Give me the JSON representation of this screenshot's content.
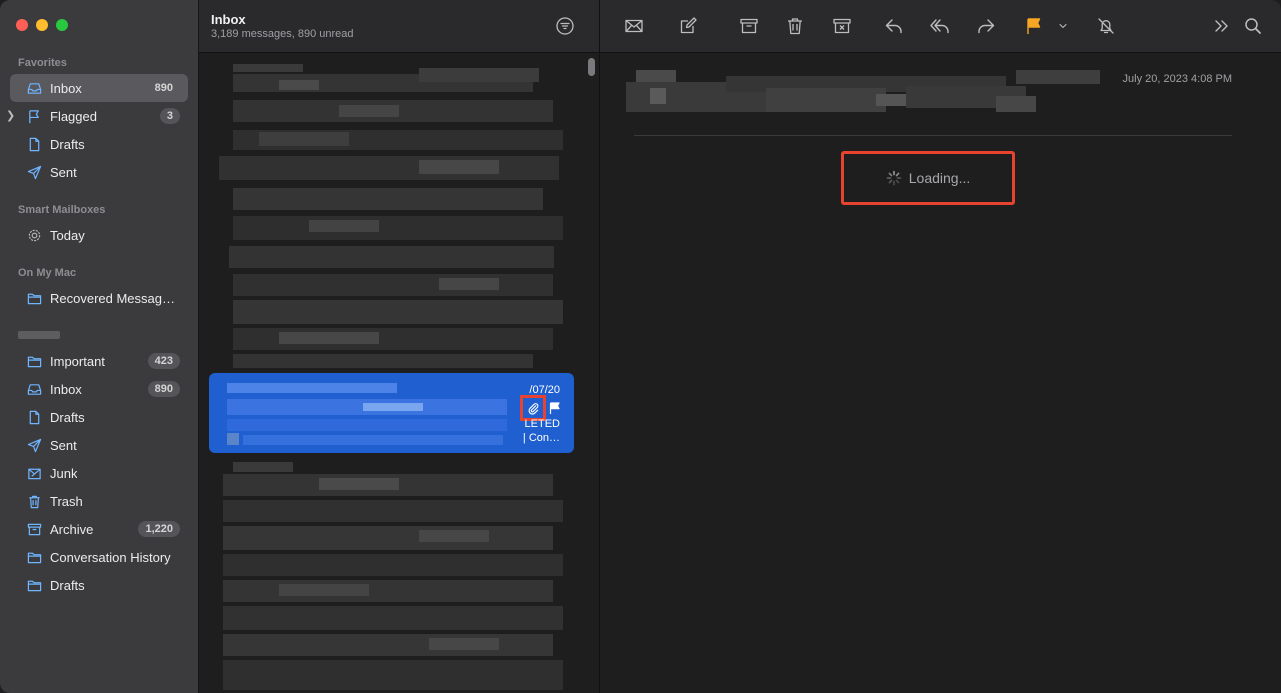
{
  "sidebar": {
    "favorites_title": "Favorites",
    "smart_title": "Smart Mailboxes",
    "onmymac_title": "On My Mac",
    "favorites": [
      {
        "label": "Inbox",
        "badge": "890",
        "icon": "inbox-icon"
      },
      {
        "label": "Flagged",
        "badge": "3",
        "icon": "flag-icon"
      },
      {
        "label": "Drafts",
        "badge": "",
        "icon": "document-icon"
      },
      {
        "label": "Sent",
        "badge": "",
        "icon": "paperplane-icon"
      }
    ],
    "smart": [
      {
        "label": "Today",
        "icon": "gear-icon"
      }
    ],
    "onmymac": [
      {
        "label": "Recovered Messag…",
        "icon": "folder-icon"
      }
    ],
    "account": [
      {
        "label": "Important",
        "badge": "423",
        "icon": "folder-icon"
      },
      {
        "label": "Inbox",
        "badge": "890",
        "icon": "inbox-icon"
      },
      {
        "label": "Drafts",
        "badge": "",
        "icon": "document-icon"
      },
      {
        "label": "Sent",
        "badge": "",
        "icon": "paperplane-icon"
      },
      {
        "label": "Junk",
        "badge": "",
        "icon": "junk-icon"
      },
      {
        "label": "Trash",
        "badge": "",
        "icon": "trash-icon"
      },
      {
        "label": "Archive",
        "badge": "1,220",
        "icon": "archive-icon"
      },
      {
        "label": "Conversation History",
        "badge": "",
        "icon": "folder-icon"
      },
      {
        "label": "Drafts",
        "badge": "",
        "icon": "folder-icon"
      }
    ]
  },
  "list": {
    "title": "Inbox",
    "subtitle": "3,189 messages, 890 unread",
    "selected": {
      "date": "/07/20",
      "preview_line1": "LETED",
      "preview_line2": "| Con…"
    }
  },
  "reader": {
    "date": "July 20, 2023 4:08 PM",
    "loading": "Loading..."
  },
  "colors": {
    "accent": "#1f5fd0",
    "highlight": "#e8432e",
    "flag": "#f5a623"
  }
}
